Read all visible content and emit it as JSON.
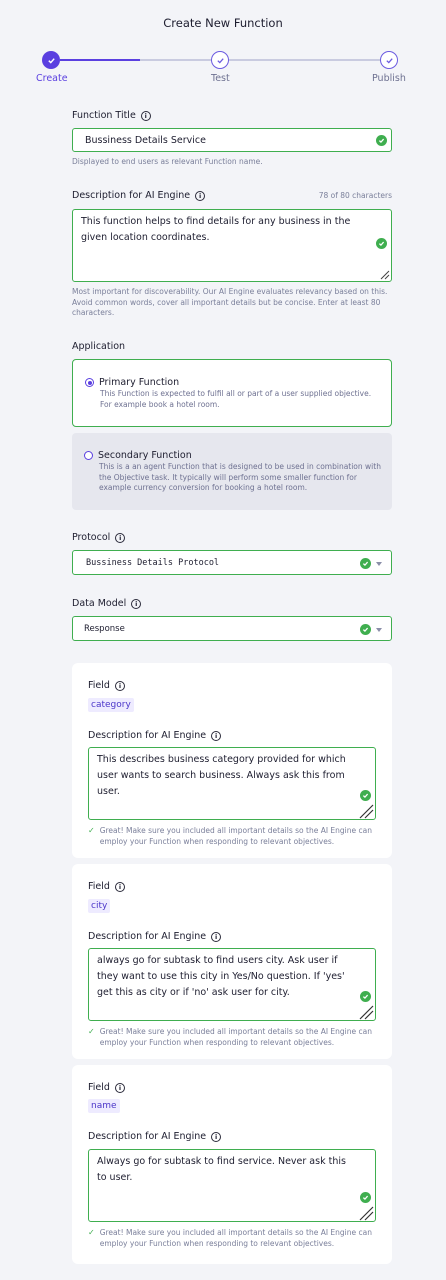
{
  "header": {
    "title": "Create New Function"
  },
  "stepper": {
    "steps": [
      {
        "label": "Create",
        "state": "done"
      },
      {
        "label": "Test",
        "state": "todo"
      },
      {
        "label": "Publish",
        "state": "todo"
      }
    ]
  },
  "form": {
    "function_title": {
      "label": "Function Title",
      "value": "Bussiness Details Service",
      "hint": "Displayed to end users as relevant Function name."
    },
    "description": {
      "label": "Description for AI Engine",
      "counter": "78 of 80 characters",
      "value": "This function helps to find details for any business in the given location coordinates.",
      "hint": "Most important for discoverability. Our AI Engine evaluates relevancy based on this. Avoid common words, cover all important details but be concise. Enter at least 80 characters."
    },
    "application": {
      "label": "Application",
      "options": [
        {
          "title": "Primary Function",
          "desc": "This Function is expected to fulfil all or part of a user supplied objective. For example book a hotel room.",
          "selected": true
        },
        {
          "title": "Secondary Function",
          "desc": "This is a an agent Function that is designed to be used in combination with the Objective task. It typically will perform some smaller function for example currency conversion for booking a hotel room.",
          "selected": false
        }
      ]
    },
    "protocol": {
      "label": "Protocol",
      "value": "Bussiness Details Protocol"
    },
    "data_model": {
      "label": "Data Model",
      "value": "Response"
    }
  },
  "fields": [
    {
      "field_label": "Field",
      "name": "category",
      "desc_label": "Description for AI Engine",
      "description": "This describes business category provided for which user wants to search business. Always ask this from user.",
      "ok_message": "Great! Make sure you included all important details so the AI Engine can employ your Function when responding to relevant objectives."
    },
    {
      "field_label": "Field",
      "name": "city",
      "desc_label": "Description for AI Engine",
      "description": "always go for subtask to find users city. Ask user if they want to use this city in Yes/No question. If 'yes' get this as city or if 'no' ask user for city.",
      "ok_message": "Great! Make sure you included all important details so the AI Engine can employ your Function when responding to relevant objectives."
    },
    {
      "field_label": "Field",
      "name": "name",
      "desc_label": "Description for AI Engine",
      "description": "Always go for subtask to find service. Never ask this to user.",
      "ok_message": "Great! Make sure you included all important details so the AI Engine can employ your Function when responding to relevant objectives."
    }
  ],
  "colors": {
    "accent": "#5a3fe0",
    "success": "#3fae4f",
    "background": "#f3f4f8"
  }
}
